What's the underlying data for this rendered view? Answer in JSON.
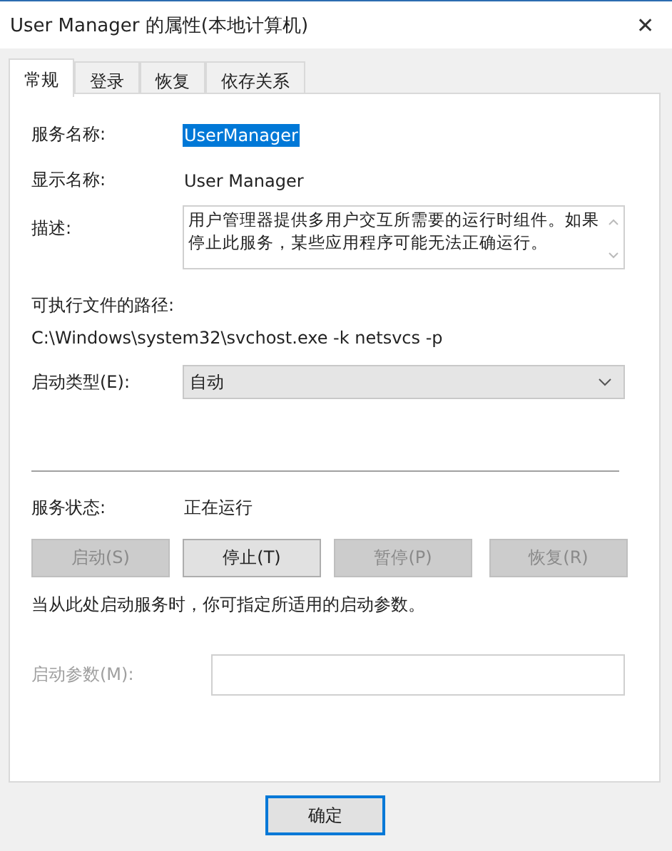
{
  "window": {
    "title": "User Manager 的属性(本地计算机)",
    "close": "✕"
  },
  "tabs": [
    {
      "label": "常规",
      "selected": true
    },
    {
      "label": "登录",
      "selected": false
    },
    {
      "label": "恢复",
      "selected": false
    },
    {
      "label": "依存关系",
      "selected": false
    }
  ],
  "service_name": {
    "label": "服务名称:",
    "value": "UserManager",
    "selected": true
  },
  "display_name": {
    "label": "显示名称:",
    "value": "User Manager"
  },
  "description": {
    "label": "描述:",
    "value": "用户管理器提供多用户交互所需要的运行时组件。如果停止此服务，某些应用程序可能无法正确运行。"
  },
  "path": {
    "label": "可执行文件的路径:",
    "value": "C:\\Windows\\system32\\svchost.exe -k netsvcs -p"
  },
  "startup_type": {
    "label": "启动类型(E):",
    "value": "自动"
  },
  "status": {
    "label": "服务状态:",
    "value": "正在运行"
  },
  "service_buttons": [
    {
      "label": "启动(S)",
      "disabled": true
    },
    {
      "label": "停止(T)",
      "disabled": false
    },
    {
      "label": "暂停(P)",
      "disabled": true
    },
    {
      "label": "恢复(R)",
      "disabled": true
    }
  ],
  "hint": "当从此处启动服务时，你可指定所适用的启动参数。",
  "start_params": {
    "label": "启动参数(M):",
    "disabled": true
  },
  "footer_buttons": [
    {
      "label": "确定",
      "default": true
    }
  ]
}
